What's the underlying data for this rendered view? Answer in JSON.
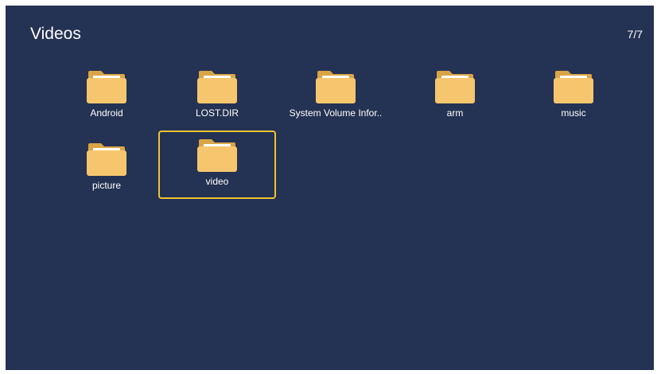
{
  "header": {
    "title": "Videos",
    "counter": "7/7"
  },
  "folders": [
    {
      "label": "Android",
      "icon": "folder-icon",
      "selected": false
    },
    {
      "label": "LOST.DIR",
      "icon": "folder-icon",
      "selected": false
    },
    {
      "label": "System Volume Infor..",
      "icon": "folder-icon",
      "selected": false
    },
    {
      "label": "arm",
      "icon": "folder-icon",
      "selected": false
    },
    {
      "label": "music",
      "icon": "folder-icon",
      "selected": false
    },
    {
      "label": "picture",
      "icon": "folder-icon",
      "selected": false
    },
    {
      "label": "video",
      "icon": "folder-icon",
      "selected": true
    }
  ],
  "colors": {
    "background": "#243253",
    "selection": "#f1c232",
    "folder": "#f6c66e",
    "folder_back": "#d9a546"
  }
}
